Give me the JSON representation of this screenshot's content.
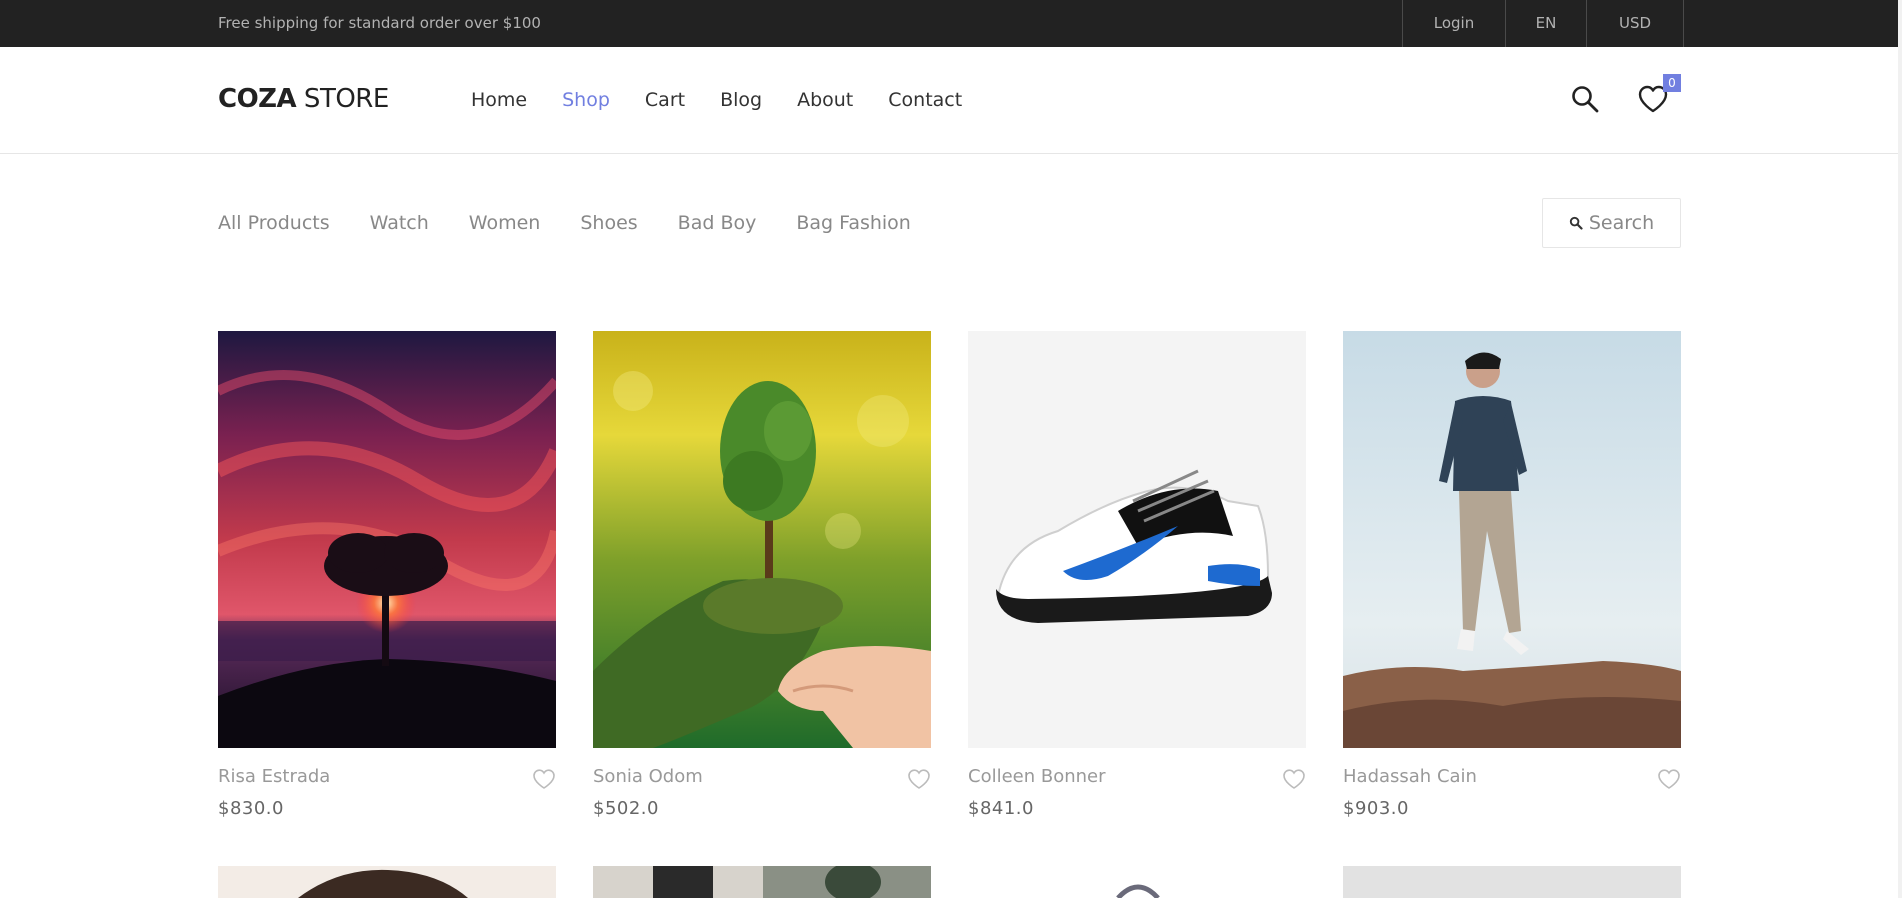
{
  "topbar": {
    "shipping_text": "Free shipping for standard order over $100",
    "links": {
      "login": "Login",
      "language": "EN",
      "currency": "USD"
    }
  },
  "header": {
    "logo_bold": "COZA",
    "logo_light": " STORE",
    "nav": [
      "Home",
      "Shop",
      "Cart",
      "Blog",
      "About",
      "Contact"
    ],
    "active_nav": "Shop",
    "wishlist_count": "0",
    "icons": {
      "search": "search-icon",
      "wishlist": "heart-icon"
    },
    "accent_color": "#717fe0"
  },
  "filters": {
    "categories": [
      "All Products",
      "Watch",
      "Women",
      "Shoes",
      "Bad Boy",
      "Bag Fashion"
    ],
    "search_label": "Search"
  },
  "products": [
    {
      "name": "Risa Estrada",
      "price": "$830.0",
      "image": "red-sky-tree-sunset"
    },
    {
      "name": "Sonia Odom",
      "price": "$502.0",
      "image": "hand-holding-tree"
    },
    {
      "name": "Colleen Bonner",
      "price": "$841.0",
      "image": "white-black-sneaker"
    },
    {
      "name": "Hadassah Cain",
      "price": "$903.0",
      "image": "man-walking-on-rocks"
    }
  ]
}
